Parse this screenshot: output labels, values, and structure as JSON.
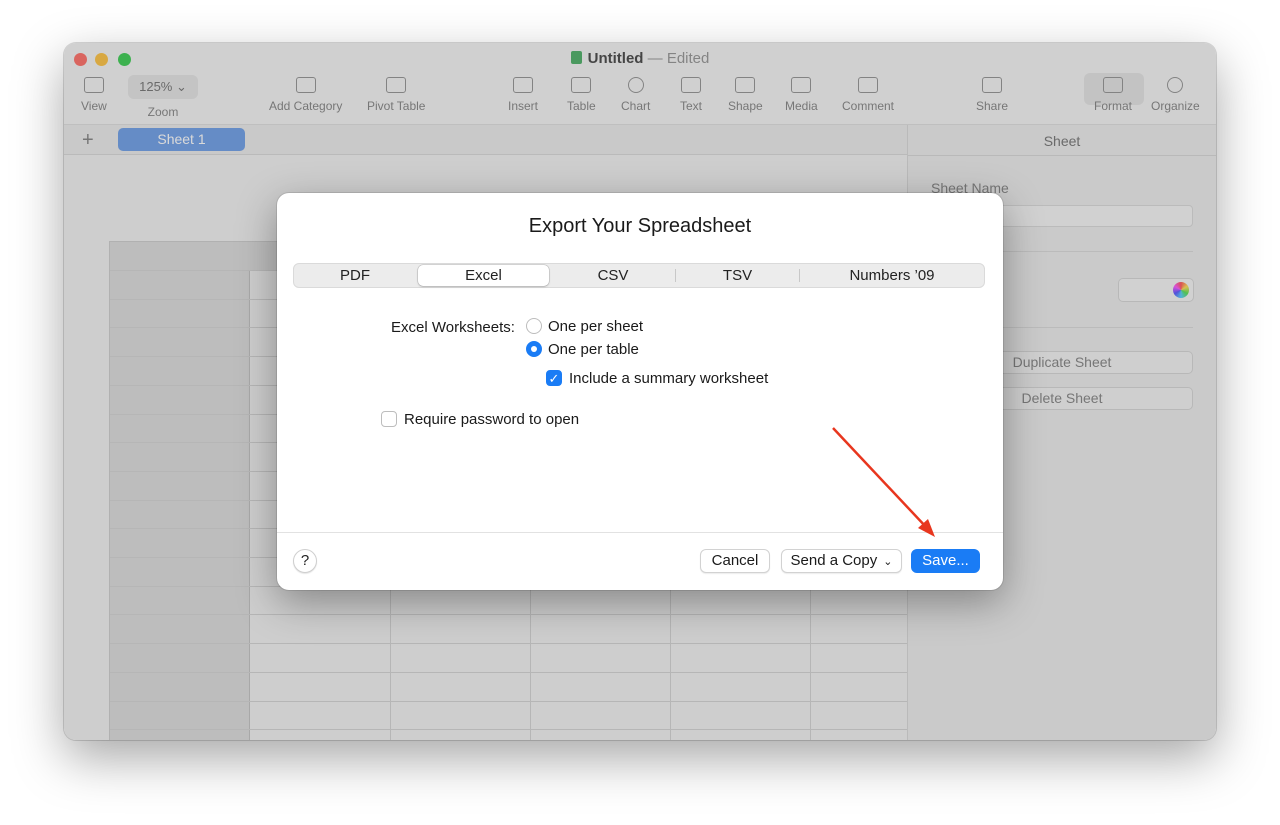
{
  "window": {
    "title": "Untitled",
    "title_separator": "—",
    "title_status": "Edited"
  },
  "toolbar": {
    "view": "View",
    "zoom_value": "125%",
    "zoom": "Zoom",
    "add_category": "Add Category",
    "pivot_table": "Pivot Table",
    "insert": "Insert",
    "table": "Table",
    "chart": "Chart",
    "text": "Text",
    "shape": "Shape",
    "media": "Media",
    "comment": "Comment",
    "share": "Share",
    "format": "Format",
    "organize": "Organize"
  },
  "tabs": {
    "add": "+",
    "sheet_1": "Sheet 1"
  },
  "inspector": {
    "title": "Sheet",
    "sheet_name_label": "Sheet Name",
    "background_label_partial": "d",
    "duplicate_sheet": "Duplicate Sheet",
    "delete_sheet": "Delete Sheet"
  },
  "dialog": {
    "title": "Export Your Spreadsheet",
    "formats": [
      "PDF",
      "Excel",
      "CSV",
      "TSV",
      "Numbers ’09"
    ],
    "selected_format": "Excel",
    "worksheets_label": "Excel Worksheets:",
    "one_per_sheet": "One per sheet",
    "one_per_table": "One per table",
    "include_summary": "Include a summary worksheet",
    "require_password": "Require password to open",
    "help": "?",
    "cancel": "Cancel",
    "send_a_copy": "Send a Copy",
    "save": "Save..."
  },
  "colors": {
    "accent": "#1a7cf5",
    "annotation_arrow": "#e8361e"
  }
}
